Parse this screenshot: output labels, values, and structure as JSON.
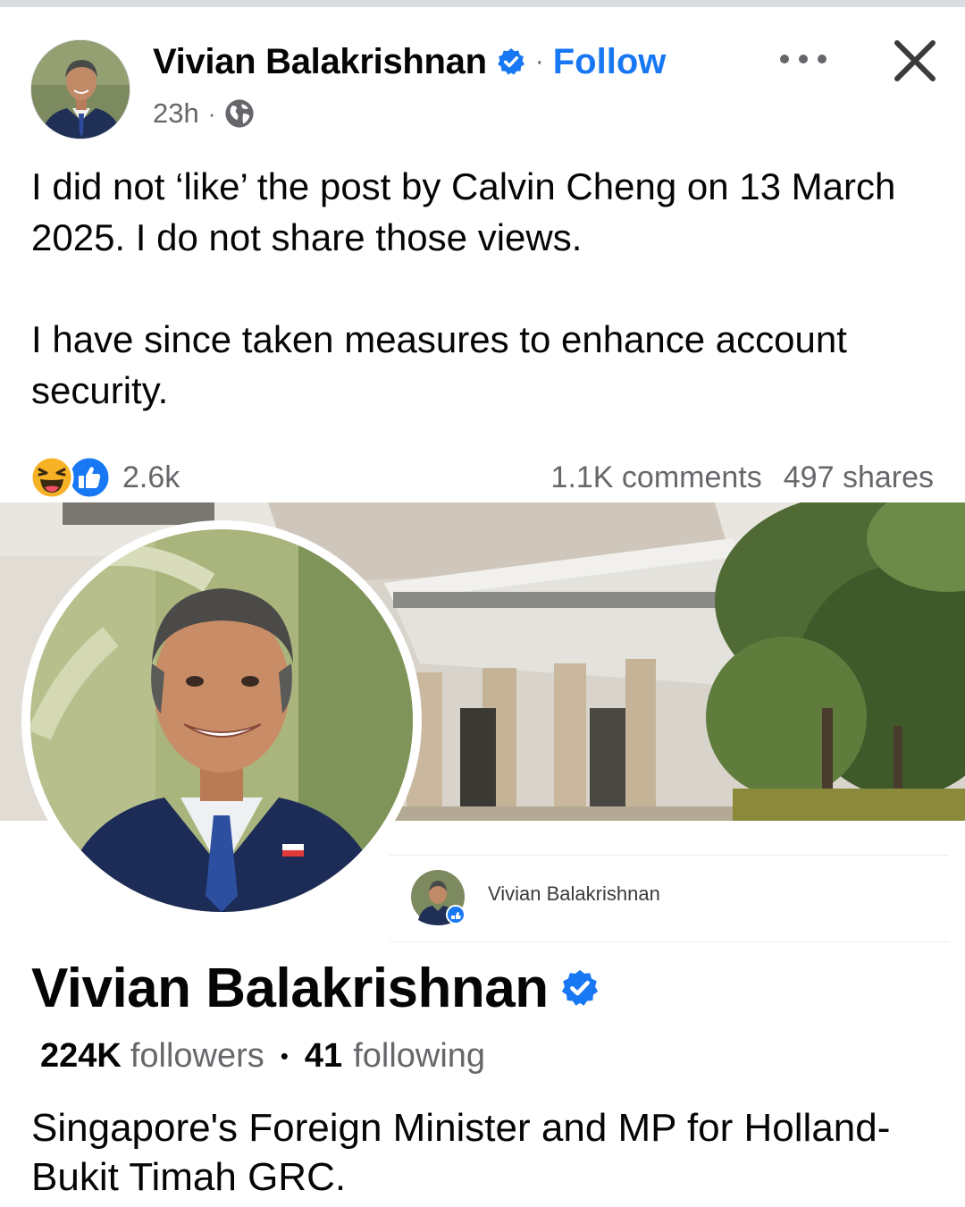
{
  "post": {
    "author": "Vivian Balakrishnan",
    "separator": "·",
    "follow_label": "Follow",
    "time": "23h",
    "meta_separator": "·",
    "paragraphs": [
      "I did not ‘like’ the post by Calvin Cheng on 13 March 2025. I do not share those views.",
      "I have since taken measures to enhance account security."
    ]
  },
  "icons": {
    "verified": "verified-badge-icon",
    "audience": "globe-icon",
    "more": "more-options-icon",
    "close": "close-icon",
    "reactions": [
      "haha-reaction-icon",
      "like-reaction-icon"
    ]
  },
  "stats": {
    "reactions_count": "2.6k",
    "comments": "1.1K comments",
    "shares": "497 shares"
  },
  "shared_image": {
    "card_name": "Vivian Balakrishnan",
    "profile_name": "Vivian Balakrishnan",
    "followers_count": "224K",
    "followers_label": "followers",
    "bullet": "•",
    "following_count": "41",
    "following_label": "following",
    "bio": "Singapore's Foreign Minister and MP for Holland-Bukit Timah GRC."
  },
  "colors": {
    "accent": "#1877f2",
    "text_primary": "#050505",
    "text_secondary": "#65676b"
  }
}
